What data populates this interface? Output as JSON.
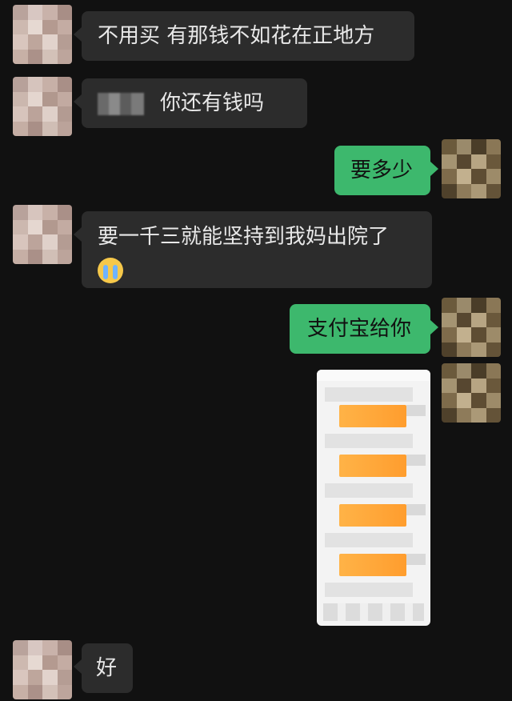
{
  "messages": [
    {
      "side": "left",
      "text": "不用买   有那钱不如花在正地方"
    },
    {
      "side": "left",
      "text": "你还有钱吗"
    },
    {
      "side": "right",
      "text": "要多少"
    },
    {
      "side": "left",
      "line1": "要一千三就能坚持到我妈出院了",
      "emoji": "crying-face"
    },
    {
      "side": "right",
      "text": "支付宝给你"
    },
    {
      "side": "right",
      "image": "payment-screenshot"
    },
    {
      "side": "left",
      "text": "好"
    }
  ],
  "colors": {
    "background": "#111111",
    "incoming_bubble": "#2c2c2c",
    "outgoing_bubble": "#3db86d"
  }
}
